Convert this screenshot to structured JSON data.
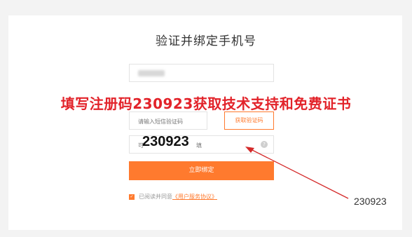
{
  "title": "验证并绑定手机号",
  "banner": "填写注册码230923获取技术支持和免费证书",
  "form": {
    "sms_placeholder": "请输入短信验证码",
    "get_code_label": "获取验证码",
    "invite_placeholder": "可",
    "invite_suffix": "填",
    "help_icon": "?",
    "bind_label": "立即绑定",
    "agree_text": "已阅读并同意",
    "agree_link": "《用户服务协议》",
    "checkbox_mark": "✓"
  },
  "overlay": {
    "code": "230923",
    "side_code": "230923"
  },
  "colors": {
    "accent": "#ff7a2e",
    "banner": "#e2232a",
    "arrow": "#d42a2a"
  }
}
